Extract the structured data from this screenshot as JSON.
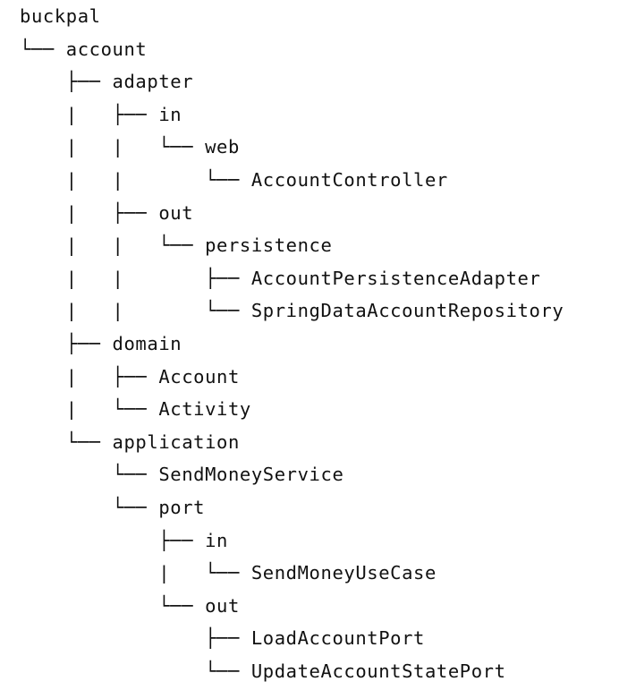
{
  "tree": {
    "lines": [
      {
        "prefix": "",
        "label": "buckpal"
      },
      {
        "prefix": "└── ",
        "label": "account"
      },
      {
        "prefix": "    ├── ",
        "label": "adapter"
      },
      {
        "prefix": "    |   ├── ",
        "label": "in"
      },
      {
        "prefix": "    |   |   └── ",
        "label": "web"
      },
      {
        "prefix": "    |   |       └── ",
        "label": "AccountController"
      },
      {
        "prefix": "    |   ├── ",
        "label": "out"
      },
      {
        "prefix": "    |   |   └── ",
        "label": "persistence"
      },
      {
        "prefix": "    |   |       ├── ",
        "label": "AccountPersistenceAdapter"
      },
      {
        "prefix": "    |   |       └── ",
        "label": "SpringDataAccountRepository"
      },
      {
        "prefix": "    ├── ",
        "label": "domain"
      },
      {
        "prefix": "    |   ├── ",
        "label": "Account"
      },
      {
        "prefix": "    |   └── ",
        "label": "Activity"
      },
      {
        "prefix": "    └── ",
        "label": "application"
      },
      {
        "prefix": "        └── ",
        "label": "SendMoneyService"
      },
      {
        "prefix": "        └── ",
        "label": "port"
      },
      {
        "prefix": "            ├── ",
        "label": "in"
      },
      {
        "prefix": "            |   └── ",
        "label": "SendMoneyUseCase"
      },
      {
        "prefix": "            └── ",
        "label": "out"
      },
      {
        "prefix": "                ├── ",
        "label": "LoadAccountPort"
      },
      {
        "prefix": "                └── ",
        "label": "UpdateAccountStatePort"
      }
    ]
  }
}
